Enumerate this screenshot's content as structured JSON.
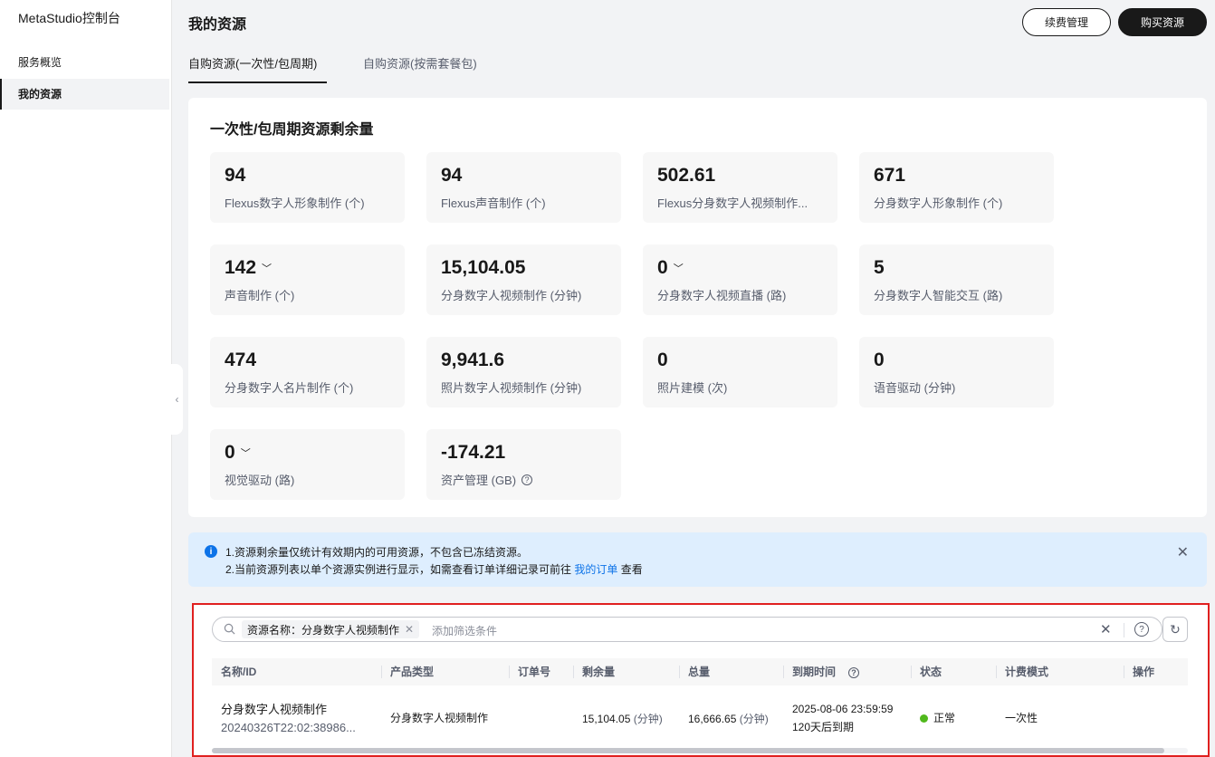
{
  "sidebar": {
    "brand": "MetaStudio控制台",
    "items": [
      {
        "label": "服务概览"
      },
      {
        "label": "我的资源"
      }
    ]
  },
  "header": {
    "title": "我的资源",
    "renew_label": "续费管理",
    "buy_label": "购买资源"
  },
  "tabs": [
    {
      "label": "自购资源(一次性/包周期)"
    },
    {
      "label": "自购资源(按需套餐包)"
    }
  ],
  "summary": {
    "title": "一次性/包周期资源剩余量",
    "stats": [
      {
        "value": "94",
        "label": "Flexus数字人形象制作 (个)"
      },
      {
        "value": "94",
        "label": "Flexus声音制作 (个)"
      },
      {
        "value": "502.61",
        "label": "Flexus分身数字人视频制作..."
      },
      {
        "value": "671",
        "label": "分身数字人形象制作 (个)"
      },
      {
        "value": "142",
        "label": "声音制作 (个)"
      },
      {
        "value": "15,104.05",
        "label": "分身数字人视频制作 (分钟)"
      },
      {
        "value": "0",
        "label": "分身数字人视频直播 (路)"
      },
      {
        "value": "5",
        "label": "分身数字人智能交互 (路)"
      },
      {
        "value": "474",
        "label": "分身数字人名片制作 (个)"
      },
      {
        "value": "9,941.6",
        "label": "照片数字人视频制作 (分钟)"
      },
      {
        "value": "0",
        "label": "照片建模 (次)"
      },
      {
        "value": "0",
        "label": "语音驱动 (分钟)"
      },
      {
        "value": "0",
        "label": "视觉驱动 (路)"
      },
      {
        "value": "-174.21",
        "label": "资产管理 (GB)"
      }
    ]
  },
  "banner": {
    "line1": "1.资源剩余量仅统计有效期内的可用资源，不包含已冻结资源。",
    "line2_prefix": "2.当前资源列表以单个资源实例进行显示，如需查看订单详细记录可前往",
    "line2_link": "我的订单",
    "line2_suffix": "查看"
  },
  "search": {
    "chip": "资源名称：分身数字人视频制作",
    "placeholder": "添加筛选条件"
  },
  "table": {
    "headers": [
      "名称/ID",
      "产品类型",
      "订单号",
      "剩余量",
      "总量",
      "到期时间",
      "状态",
      "计费模式",
      "操作"
    ],
    "rows": [
      {
        "name": "分身数字人视频制作",
        "id": "20240326T22:02:38986...",
        "product_type": "分身数字人视频制作",
        "order_no": "",
        "remaining": "15,104.05",
        "remaining_unit": "(分钟)",
        "total": "16,666.65",
        "total_unit": "(分钟)",
        "expire_time": "2025-08-06 23:59:59",
        "expire_note": "120天后到期",
        "status": "正常",
        "billing": "一次性"
      }
    ]
  },
  "colors": {
    "accent": "#191919",
    "link": "#0d73e8",
    "banner_bg": "#deeefe",
    "status_ok": "#50b91c",
    "highlight_border": "#e0201f"
  }
}
